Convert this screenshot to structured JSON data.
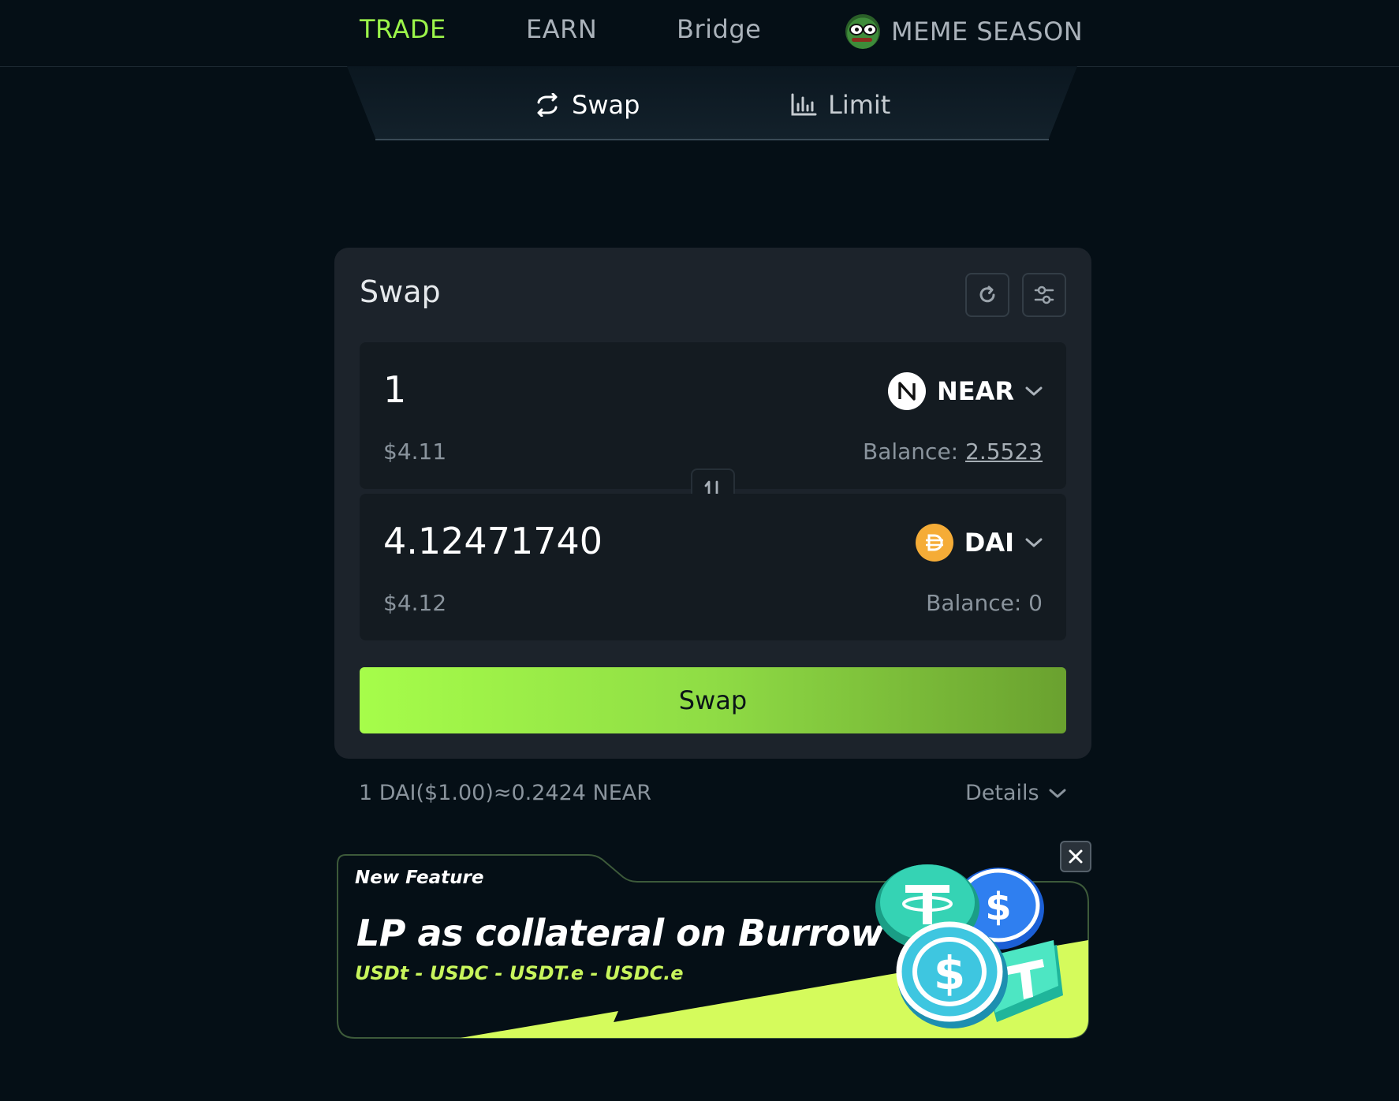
{
  "nav": {
    "trade": "TRADE",
    "earn": "EARN",
    "bridge": "Bridge",
    "meme": "MEME SEASON"
  },
  "subtabs": {
    "swap": "Swap",
    "limit": "Limit"
  },
  "card": {
    "title": "Swap",
    "from": {
      "amount": "1",
      "token": "NEAR",
      "usd": "$4.11",
      "balance_label": "Balance:",
      "balance_value": "2.5523"
    },
    "to": {
      "amount": "4.12471740",
      "token": "DAI",
      "usd": "$4.12",
      "balance_label": "Balance:",
      "balance_value": "0"
    },
    "swap_button": "Swap"
  },
  "rate": "1 DAI($1.00)≈0.2424 NEAR",
  "details": "Details",
  "banner": {
    "tag": "New Feature",
    "headline": "LP as collateral on Burrow",
    "tokens": "USDt - USDC - USDT.e - USDC.e"
  },
  "colors": {
    "accent": "#9cf54a",
    "background": "#050f16",
    "card": "#1c232b",
    "dai": "#f5ac37"
  }
}
